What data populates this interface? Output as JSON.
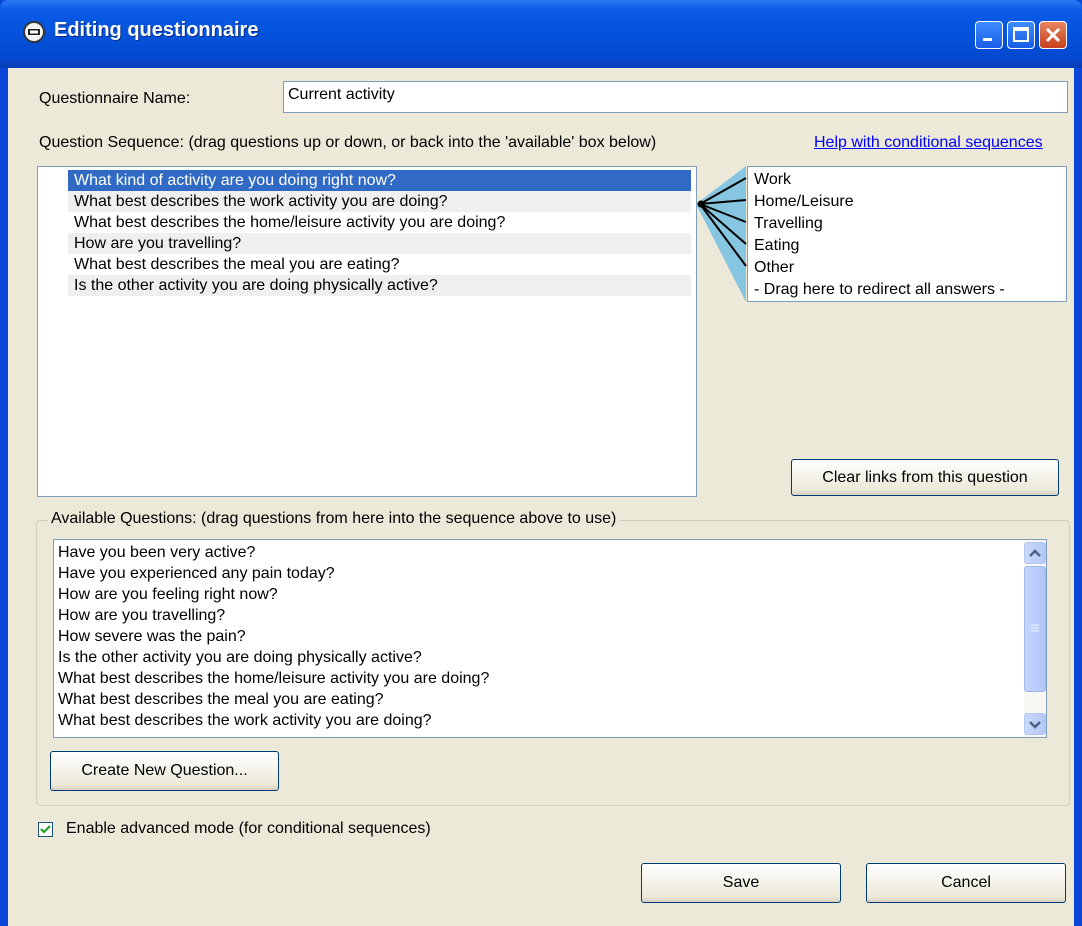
{
  "window": {
    "title": "Editing questionnaire"
  },
  "form": {
    "name_label": "Questionnaire Name:",
    "name_value": "Current activity",
    "sequence_label": "Question Sequence: (drag questions up or down, or back into the 'available' box below)",
    "help_link": "Help with conditional sequences"
  },
  "sequence": {
    "selected_index": 0,
    "items": [
      "What kind of activity are you doing right now?",
      "What best describes the work activity you are doing?",
      "What best describes the home/leisure activity you are doing?",
      "How are you travelling?",
      "What best describes the meal you are eating?",
      "Is the other activity you are doing physically active?"
    ]
  },
  "answers": {
    "items": [
      "Work",
      "Home/Leisure",
      "Travelling",
      "Eating",
      "Other",
      "- Drag here to redirect all answers -"
    ]
  },
  "clear_links_button": "Clear links from this question",
  "available": {
    "group_title": "Available Questions: (drag questions from here into the sequence above to use)",
    "items": [
      "Have you been very active?",
      "Have you experienced any pain today?",
      "How are you feeling right now?",
      "How are you travelling?",
      "How severe was the pain?",
      "Is the other activity you are doing physically active?",
      "What best describes the home/leisure activity you are doing?",
      "What best describes the meal you are eating?",
      "What best describes the work activity you are doing?"
    ],
    "create_button": "Create New Question..."
  },
  "advanced": {
    "label": "Enable advanced mode (for conditional sequences)",
    "checked": true
  },
  "footer": {
    "save_label": "Save",
    "cancel_label": "Cancel"
  },
  "colors": {
    "titlebar": "#0453dc",
    "selection": "#316ac5",
    "link_fan": "#87c6e0",
    "dialog_bg": "#ece9d8"
  },
  "icons": {
    "app": "app-icon",
    "minimize": "minimize-icon",
    "maximize": "maximize-icon",
    "close": "close-icon",
    "scroll_up": "scroll-up-arrow-icon",
    "scroll_down": "scroll-down-arrow-icon",
    "check": "check-icon"
  }
}
